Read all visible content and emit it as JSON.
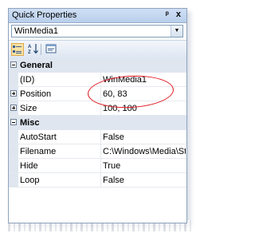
{
  "window": {
    "title": "Quick Properties",
    "pin_glyph": "\u0004",
    "close_glyph": "x"
  },
  "selector": {
    "value": "WinMedia1"
  },
  "toolbar": {
    "categorized_icon": "categorized-icon",
    "alphabetical_icon": "alphabetical-sort-icon",
    "property_pages_icon": "property-pages-icon"
  },
  "categories": [
    {
      "name": "General",
      "expanded": true,
      "properties": [
        {
          "name": "(ID)",
          "value": "WinMedia1",
          "expandable": false
        },
        {
          "name": "Position",
          "value": "60, 83",
          "expandable": true
        },
        {
          "name": "Size",
          "value": "100, 100",
          "expandable": true
        }
      ]
    },
    {
      "name": "Misc",
      "expanded": true,
      "properties": [
        {
          "name": "AutoStart",
          "value": "False",
          "expandable": false
        },
        {
          "name": "Filename",
          "value": "C:\\Windows\\Media\\Sta",
          "expandable": false
        },
        {
          "name": "Hide",
          "value": "True",
          "expandable": false
        },
        {
          "name": "Loop",
          "value": "False",
          "expandable": false
        }
      ]
    }
  ],
  "colors": {
    "highlight": "#e0141e",
    "titlebar": "#c4d8f0",
    "category_bg": "#dfe6ef"
  }
}
